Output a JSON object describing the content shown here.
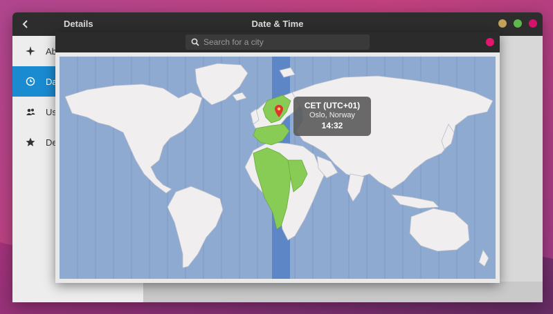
{
  "window": {
    "left_title": "Details",
    "center_title": "Date & Time",
    "buttons": {
      "minimize_color": "#c2a357",
      "maximize_color": "#5fb84a",
      "close_color": "#d9106a"
    }
  },
  "sidebar": {
    "items": [
      {
        "label": "Ab",
        "icon": "star-sparkle-icon",
        "active": false
      },
      {
        "label": "Da",
        "icon": "clock-icon",
        "active": true
      },
      {
        "label": "Us",
        "icon": "users-icon",
        "active": false
      },
      {
        "label": "De",
        "icon": "star-icon",
        "active": false
      }
    ],
    "active_color": "#1a8ad1"
  },
  "dialog": {
    "search": {
      "placeholder": "Search for a city",
      "value": ""
    },
    "close_color": "#e3156e"
  },
  "map": {
    "ocean_color": "#8faad0",
    "land_color": "#f0eeee",
    "selected_zone_color": "#88cc55",
    "zone_band_color": "#5d86c6",
    "tooltip": {
      "timezone": "CET (UTC+01)",
      "city": "Oslo, Norway",
      "time": "14:32"
    }
  }
}
